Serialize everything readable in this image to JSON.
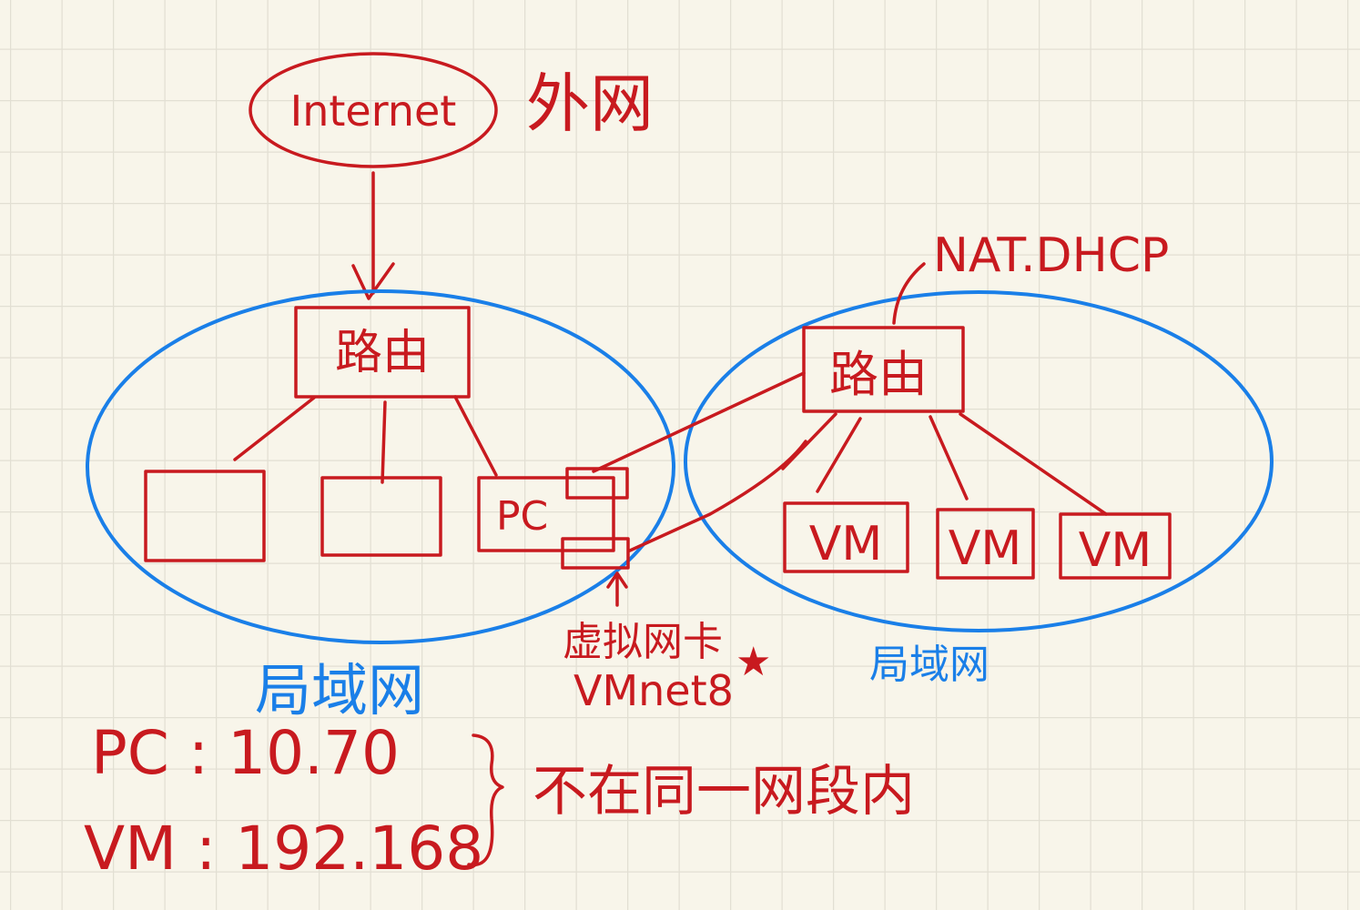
{
  "colors": {
    "ink_red": "#c81a1f",
    "ink_blue": "#1a7fe8",
    "paper": "#f8f5ea",
    "grid": "#e2dfd3"
  },
  "internet": {
    "label": "Internet",
    "note": "外网"
  },
  "left_lan": {
    "router": "路由",
    "devices": [
      "",
      "",
      "PC"
    ],
    "label": "局域网"
  },
  "right_lan": {
    "router": "路由",
    "router_note": "NAT.DHCP",
    "devices": [
      "VM",
      "VM",
      "VM"
    ],
    "label": "局域网"
  },
  "virtual_nic": {
    "label": "虚拟网卡",
    "name": "VMnet8",
    "mark": "★"
  },
  "addresses": [
    {
      "host": "PC",
      "ip": "PC : 10.70"
    },
    {
      "host": "VM",
      "ip": "VM : 192.168"
    }
  ],
  "address_note": "不在同一网段内"
}
